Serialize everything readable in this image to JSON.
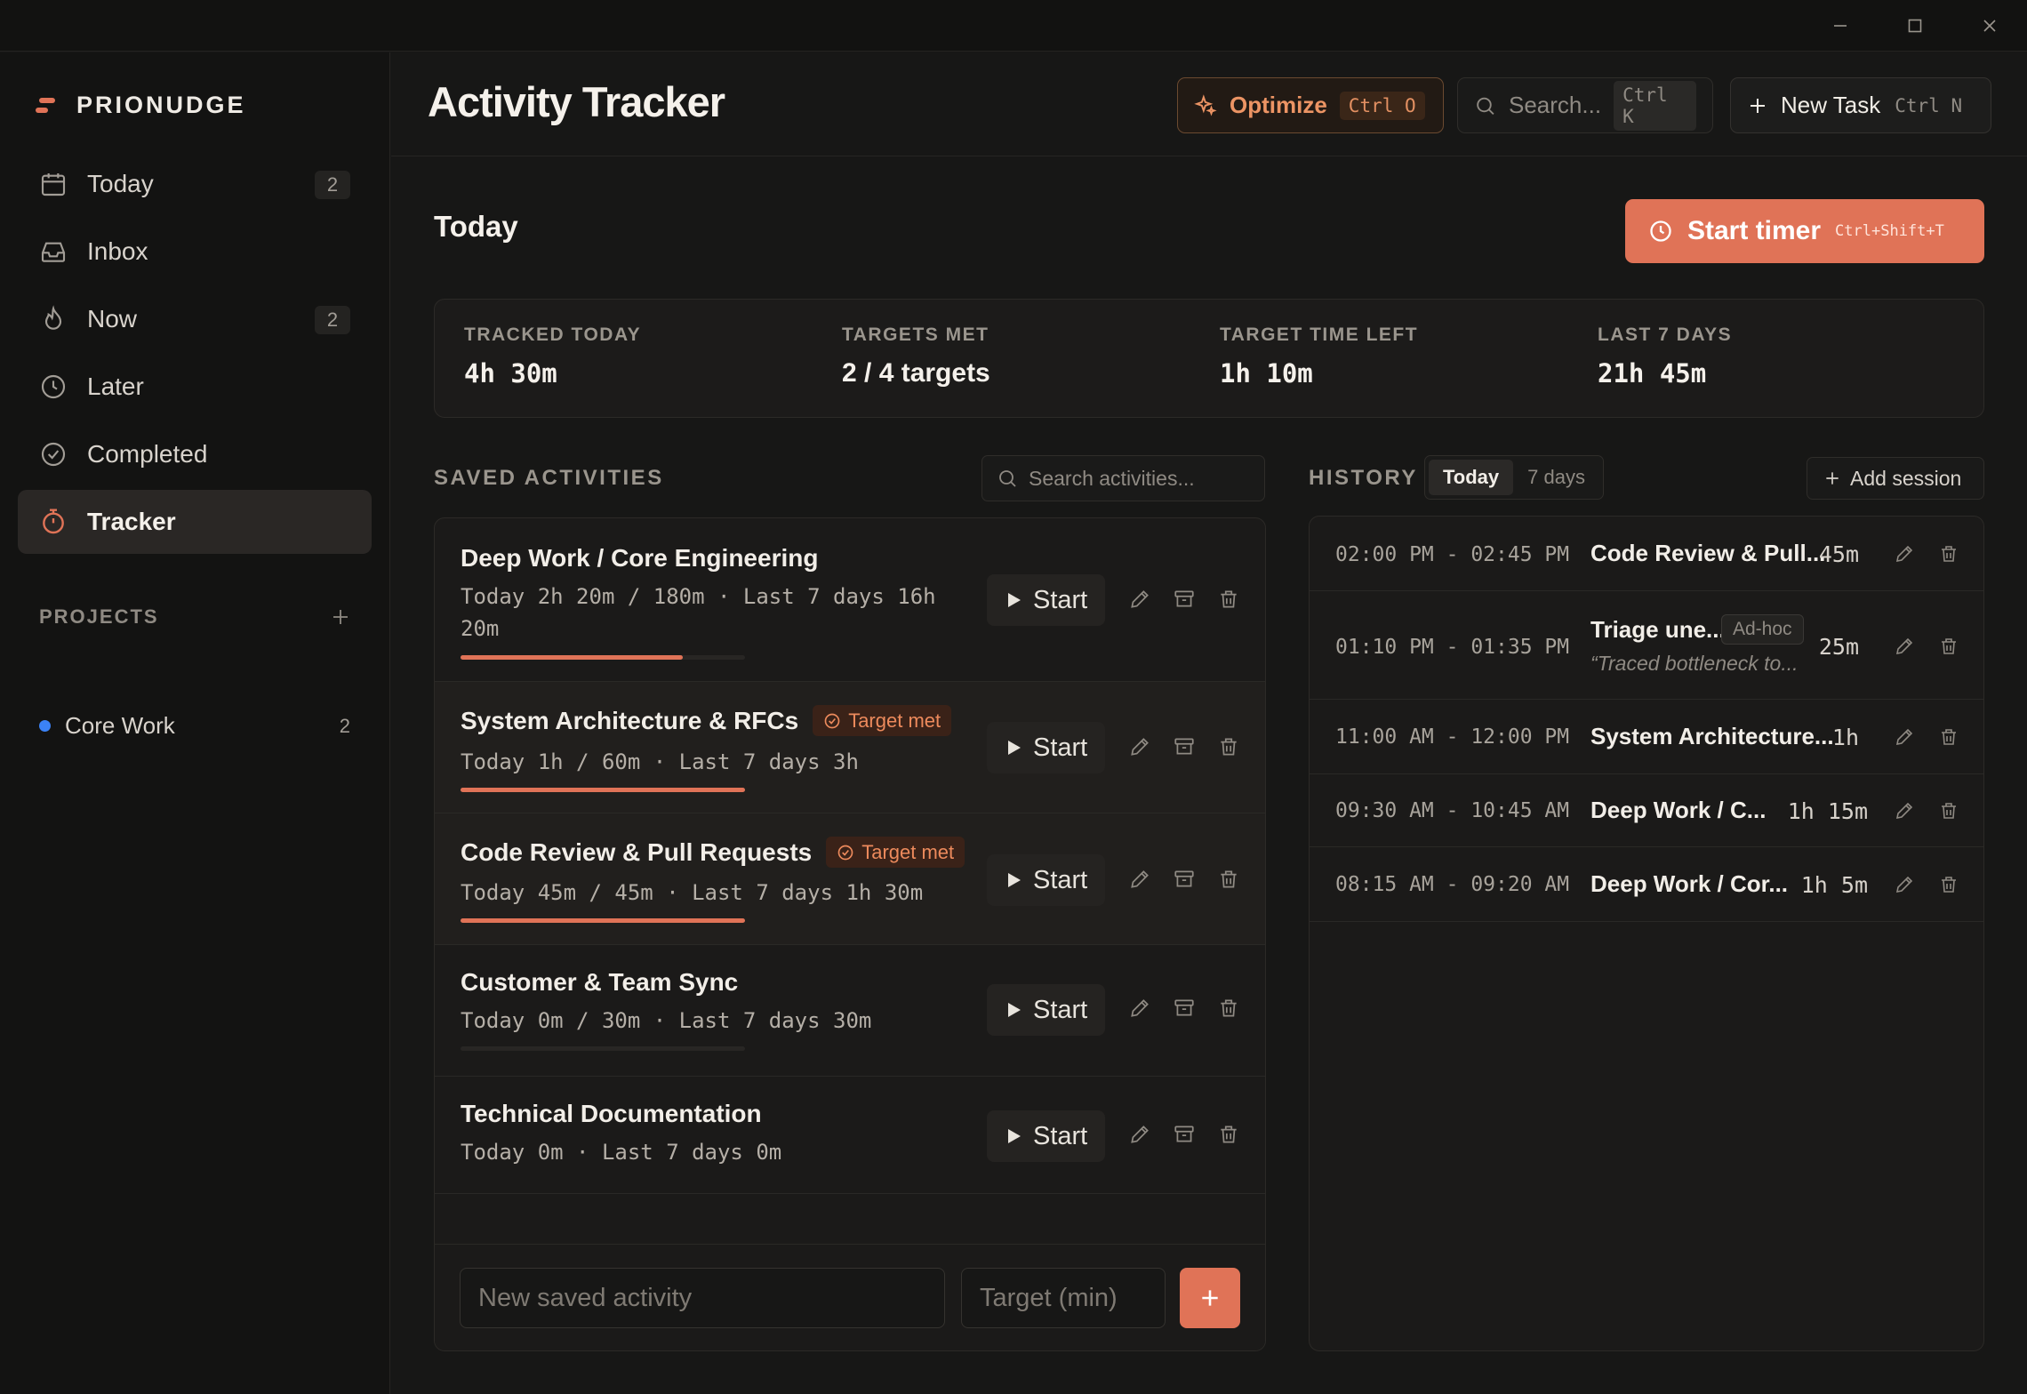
{
  "app": {
    "brand": "PRIONUDGE"
  },
  "sidebar": {
    "items": [
      {
        "label": "Today",
        "count": "2",
        "icon": "calendar-icon"
      },
      {
        "label": "Inbox",
        "count": "",
        "icon": "inbox-icon"
      },
      {
        "label": "Now",
        "count": "2",
        "icon": "flame-icon"
      },
      {
        "label": "Later",
        "count": "",
        "icon": "clock-icon"
      },
      {
        "label": "Completed",
        "count": "",
        "icon": "check-circle-icon"
      },
      {
        "label": "Tracker",
        "count": "",
        "icon": "stopwatch-icon",
        "active": true
      }
    ],
    "projects_title": "PROJECTS",
    "projects": [
      {
        "name": "Core Work",
        "count": "2",
        "color": "#3b82f6"
      }
    ]
  },
  "header": {
    "title": "Activity Tracker",
    "optimize_label": "Optimize",
    "optimize_kbd": "Ctrl O",
    "search_placeholder": "Search...",
    "search_kbd": "Ctrl K",
    "new_task_label": "New Task",
    "new_task_kbd": "Ctrl N"
  },
  "main": {
    "section_title": "Today",
    "start_timer_label": "Start timer",
    "start_timer_kbd": "Ctrl+Shift+T",
    "stats": [
      {
        "label": "TRACKED TODAY",
        "value": "4h 30m"
      },
      {
        "label": "TARGETS MET",
        "value": "2 / 4 targets"
      },
      {
        "label": "TARGET TIME LEFT",
        "value": "1h 10m"
      },
      {
        "label": "LAST 7 DAYS",
        "value": "21h 45m"
      }
    ]
  },
  "saved": {
    "title": "SAVED ACTIVITIES",
    "search_placeholder": "Search activities...",
    "start_label": "Start",
    "target_met_label": "Target met",
    "activities": [
      {
        "name": "Deep Work / Core Engineering",
        "meta_line1": "Today 2h 20m / 180m · Last 7 days 16h",
        "meta_line2": "20m",
        "progress": 0.78,
        "target_met": false
      },
      {
        "name": "System Architecture & RFCs",
        "meta_line1": "Today 1h / 60m · Last 7 days 3h",
        "progress": 1.0,
        "target_met": true
      },
      {
        "name": "Code Review & Pull Requests",
        "meta_line1": "Today 45m / 45m · Last 7 days 1h 30m",
        "progress": 1.0,
        "target_met": true
      },
      {
        "name": "Customer & Team Sync",
        "meta_line1": "Today 0m / 30m · Last 7 days 30m",
        "progress": 0.0,
        "target_met": false
      },
      {
        "name": "Technical Documentation",
        "meta_line1": "Today 0m · Last 7 days 0m",
        "target_met": false
      }
    ],
    "new_name_placeholder": "New saved activity",
    "new_target_placeholder": "Target (min)",
    "accent": "#e07357"
  },
  "history": {
    "title": "HISTORY",
    "tabs": [
      {
        "label": "Today",
        "active": true
      },
      {
        "label": "7 days",
        "active": false
      }
    ],
    "add_session_label": "Add session",
    "sessions": [
      {
        "time": "02:00 PM - 02:45 PM",
        "name": "Code Review & Pull...",
        "duration": "45m"
      },
      {
        "time": "01:10 PM - 01:35 PM",
        "name": "Triage une...",
        "badge": "Ad-hoc",
        "note": "“Traced bottleneck to...",
        "duration": "25m"
      },
      {
        "time": "11:00 AM - 12:00 PM",
        "name": "System Architecture...",
        "duration": "1h"
      },
      {
        "time": "09:30 AM - 10:45 AM",
        "name": "Deep Work / C...",
        "duration": "1h 15m"
      },
      {
        "time": "08:15 AM - 09:20 AM",
        "name": "Deep Work / Cor...",
        "duration": "1h 5m"
      }
    ]
  }
}
